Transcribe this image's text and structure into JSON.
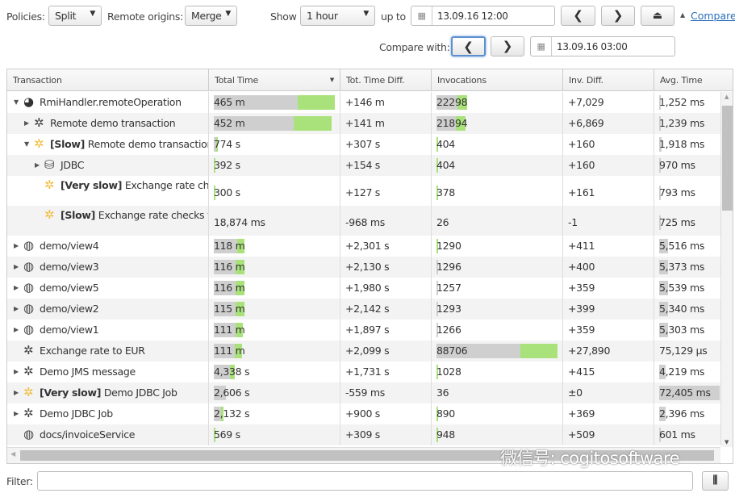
{
  "toolbar": {
    "policies_label": "Policies:",
    "policies_value": "Split",
    "remote_label": "Remote origins:",
    "remote_value": "Merge",
    "show_label": "Show",
    "show_value": "1 hour",
    "upto_label": "up to",
    "upto_value": "13.09.16 12:00",
    "compare_link": "Compare",
    "compare_with_label": "Compare with:",
    "compare_with_value": "13.09.16 03:00"
  },
  "columns": [
    "Transaction",
    "Total Time",
    "Tot. Time Diff.",
    "Invocations",
    "Inv. Diff.",
    "Avg. Time"
  ],
  "sort_column": "Total Time",
  "sort_direction": "descending",
  "rows": [
    {
      "level": 0,
      "caret": "expanded",
      "icon": "remote-icon",
      "prefix": "",
      "name": "RmiHandler.remoteOperation",
      "total": "465 m",
      "total_bar": [
        0.69,
        0.31
      ],
      "tdiff": "+146 m",
      "inv": "22298",
      "inv_bar": [
        0.17,
        0.08
      ],
      "idiff": "+7,029",
      "avg": "1,252 ms",
      "avg_bar": 0.03
    },
    {
      "level": 1,
      "caret": "collapsed",
      "icon": "gear-icon",
      "prefix": "",
      "name": "Remote demo transaction",
      "total": "452 m",
      "total_bar": [
        0.66,
        0.31
      ],
      "tdiff": "+141 m",
      "inv": "21894",
      "inv_bar": [
        0.16,
        0.08
      ],
      "idiff": "+6,869",
      "avg": "1,239 ms",
      "avg_bar": 0.03
    },
    {
      "level": 1,
      "caret": "expanded",
      "icon": "slow-gear-icon",
      "prefix": "[Slow]",
      "name": "Remote demo transaction",
      "total": "774 s",
      "total_bar": [
        0.02,
        0.01
      ],
      "tdiff": "+307 s",
      "inv": "404",
      "inv_bar": [
        0,
        0.01
      ],
      "idiff": "+160",
      "avg": "1,918 ms",
      "avg_bar": 0.04
    },
    {
      "level": 2,
      "caret": "collapsed",
      "icon": "database-icon",
      "prefix": "",
      "name": "JDBC",
      "total": "392 s",
      "total_bar": [
        0,
        0.01
      ],
      "tdiff": "+154 s",
      "inv": "404",
      "inv_bar": [
        0,
        0.01
      ],
      "idiff": "+160",
      "avg": "970 ms",
      "avg_bar": 0.02
    },
    {
      "level": 2,
      "caret": "none",
      "icon": "slow-gear-icon",
      "prefix": "[Very slow]",
      "name": "Exchange rate checks via webservice",
      "total": "300 s",
      "total_bar": [
        0,
        0.01
      ],
      "tdiff": "+127 s",
      "inv": "378",
      "inv_bar": [
        0,
        0.01
      ],
      "idiff": "+161",
      "avg": "793 ms",
      "avg_bar": 0.02,
      "tall": true
    },
    {
      "level": 2,
      "caret": "none",
      "icon": "slow-gear-icon",
      "prefix": "[Slow]",
      "name": "Exchange rate checks via webservice",
      "total": "18,874 ms",
      "total_bar": [
        0,
        0
      ],
      "tdiff": "-968 ms",
      "inv": "26",
      "inv_bar": [
        0,
        0
      ],
      "idiff": "-1",
      "avg": "725 ms",
      "avg_bar": 0.02,
      "tall": true
    },
    {
      "level": 0,
      "caret": "collapsed",
      "icon": "globe-icon",
      "prefix": "",
      "name": "demo/view4",
      "total": "118 m",
      "total_bar": [
        0.19,
        0.06
      ],
      "tdiff": "+2,301 s",
      "inv": "1290",
      "inv_bar": [
        0,
        0.01
      ],
      "idiff": "+411",
      "avg": "5,516 ms",
      "avg_bar": 0.14
    },
    {
      "level": 0,
      "caret": "collapsed",
      "icon": "globe-icon",
      "prefix": "",
      "name": "demo/view3",
      "total": "116 m",
      "total_bar": [
        0.18,
        0.07
      ],
      "tdiff": "+2,130 s",
      "inv": "1296",
      "inv_bar": [
        0.01,
        0
      ],
      "idiff": "+400",
      "avg": "5,373 ms",
      "avg_bar": 0.14
    },
    {
      "level": 0,
      "caret": "collapsed",
      "icon": "globe-icon",
      "prefix": "",
      "name": "demo/view5",
      "total": "116 m",
      "total_bar": [
        0.18,
        0.07
      ],
      "tdiff": "+1,980 s",
      "inv": "1257",
      "inv_bar": [
        0.01,
        0
      ],
      "idiff": "+359",
      "avg": "5,539 ms",
      "avg_bar": 0.14
    },
    {
      "level": 0,
      "caret": "collapsed",
      "icon": "globe-icon",
      "prefix": "",
      "name": "demo/view2",
      "total": "115 m",
      "total_bar": [
        0.18,
        0.07
      ],
      "tdiff": "+2,142 s",
      "inv": "1293",
      "inv_bar": [
        0.01,
        0
      ],
      "idiff": "+399",
      "avg": "5,340 ms",
      "avg_bar": 0.14
    },
    {
      "level": 0,
      "caret": "collapsed",
      "icon": "globe-icon",
      "prefix": "",
      "name": "demo/view1",
      "total": "111 m",
      "total_bar": [
        0.18,
        0.06
      ],
      "tdiff": "+1,897 s",
      "inv": "1266",
      "inv_bar": [
        0.01,
        0
      ],
      "idiff": "+359",
      "avg": "5,303 ms",
      "avg_bar": 0.14
    },
    {
      "level": 0,
      "caret": "none",
      "icon": "gear-icon",
      "prefix": "",
      "name": "Exchange rate to EUR",
      "total": "111 m",
      "total_bar": [
        0.17,
        0.06
      ],
      "tdiff": "+2,099 s",
      "inv": "88706",
      "inv_bar": [
        0.69,
        0.31
      ],
      "idiff": "+27,890",
      "avg": "75,129 µs",
      "avg_bar": 0
    },
    {
      "level": 0,
      "caret": "collapsed",
      "icon": "gear-icon",
      "prefix": "",
      "name": "Demo JMS message",
      "total": "4,338 s",
      "total_bar": [
        0.13,
        0.04
      ],
      "tdiff": "+1,731 s",
      "inv": "1028",
      "inv_bar": [
        0,
        0.01
      ],
      "idiff": "+415",
      "avg": "4,219 ms",
      "avg_bar": 0.11
    },
    {
      "level": 0,
      "caret": "collapsed",
      "icon": "slow-gear-icon",
      "prefix": "[Very slow]",
      "name": "Demo JDBC Job",
      "total": "2,606 s",
      "total_bar": [
        0.1,
        0
      ],
      "tdiff": "-559 ms",
      "inv": "36",
      "inv_bar": [
        0,
        0
      ],
      "idiff": "±0",
      "avg": "72,405 ms",
      "avg_bar": 1.0
    },
    {
      "level": 0,
      "caret": "collapsed",
      "icon": "gear-icon",
      "prefix": "",
      "name": "Demo JDBC Job",
      "total": "2,132 s",
      "total_bar": [
        0.06,
        0.02
      ],
      "tdiff": "+900 s",
      "inv": "890",
      "inv_bar": [
        0,
        0.01
      ],
      "idiff": "+369",
      "avg": "2,396 ms",
      "avg_bar": 0.1
    },
    {
      "level": 0,
      "caret": "none",
      "icon": "globe-icon",
      "prefix": "",
      "name": "docs/invoiceService",
      "total": "569 s",
      "total_bar": [
        0,
        0.01
      ],
      "tdiff": "+309 s",
      "inv": "948",
      "inv_bar": [
        0,
        0.01
      ],
      "idiff": "+509",
      "avg": "601 ms",
      "avg_bar": 0.02
    }
  ],
  "filter": {
    "label": "Filter:",
    "value": ""
  },
  "watermark": "微信号: cogitosoftware",
  "colors": {
    "bar_previous": "#cfcfcf",
    "bar_increase": "#a9e27a",
    "link": "#2a6ebb",
    "focus": "#5b8fcf"
  }
}
